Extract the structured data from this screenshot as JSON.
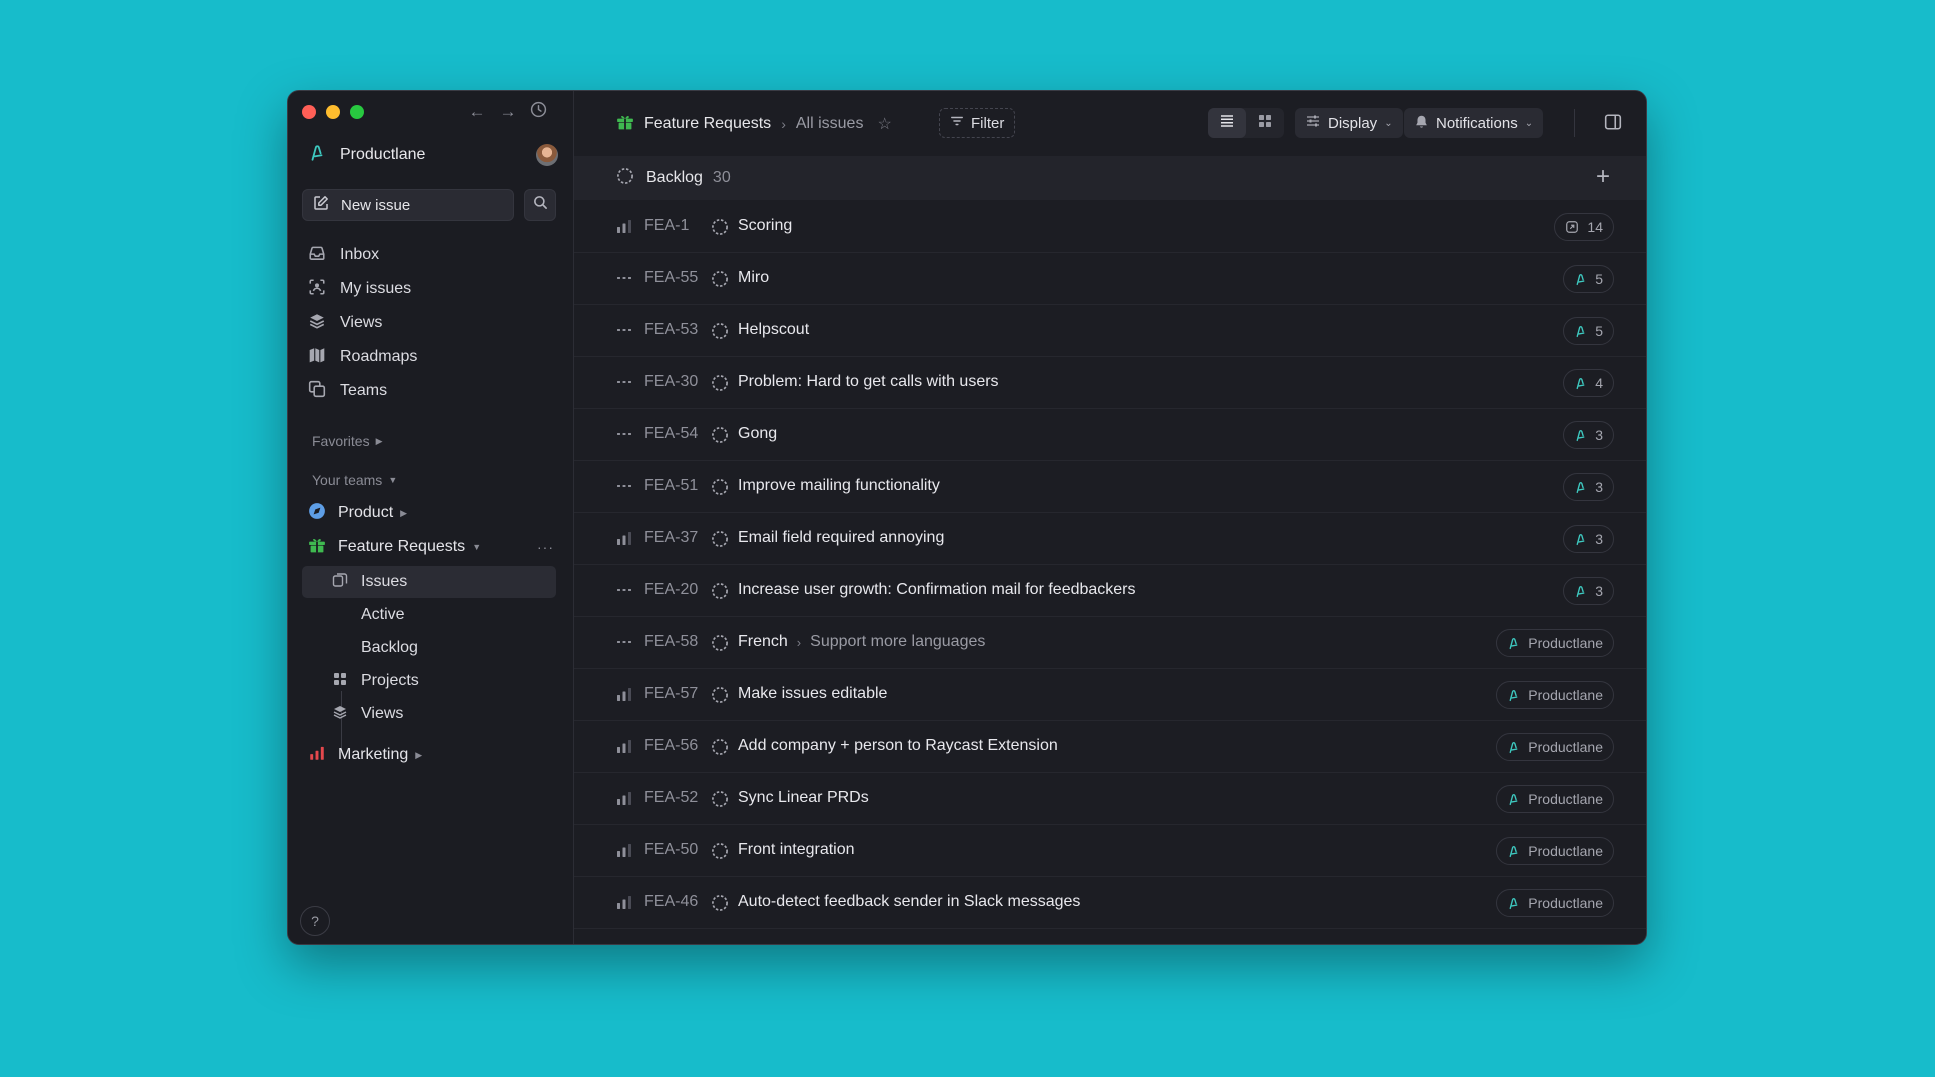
{
  "sidebar": {
    "workspace": "Productlane",
    "new_issue": "New issue",
    "nav": [
      {
        "label": "Inbox"
      },
      {
        "label": "My issues"
      },
      {
        "label": "Views"
      },
      {
        "label": "Roadmaps"
      },
      {
        "label": "Teams"
      }
    ],
    "favorites_label": "Favorites",
    "your_teams_label": "Your teams",
    "teams": [
      {
        "label": "Product"
      },
      {
        "label": "Feature Requests"
      },
      {
        "label": "Marketing"
      }
    ],
    "feature_requests_items": [
      "Issues",
      "Active",
      "Backlog",
      "Projects",
      "Views"
    ],
    "more_glyph": "···",
    "help_glyph": "?"
  },
  "header": {
    "team": "Feature Requests",
    "separator": "›",
    "view": "All issues",
    "filter": "Filter",
    "display": "Display",
    "notifications": "Notifications"
  },
  "group": {
    "label": "Backlog",
    "count": "30"
  },
  "issues": [
    {
      "id": "FEA-1",
      "title": "Scoring",
      "badge": "14",
      "badge_icon": "message-icon",
      "priority": "medium"
    },
    {
      "id": "FEA-55",
      "title": "Miro",
      "badge": "5",
      "badge_icon": "productlane-icon",
      "priority": "none"
    },
    {
      "id": "FEA-53",
      "title": "Helpscout",
      "badge": "5",
      "badge_icon": "productlane-icon",
      "priority": "none"
    },
    {
      "id": "FEA-30",
      "title": "Problem: Hard to get calls with users",
      "badge": "4",
      "badge_icon": "productlane-icon",
      "priority": "none"
    },
    {
      "id": "FEA-54",
      "title": "Gong",
      "badge": "3",
      "badge_icon": "productlane-icon",
      "priority": "none"
    },
    {
      "id": "FEA-51",
      "title": "Improve mailing functionality",
      "badge": "3",
      "badge_icon": "productlane-icon",
      "priority": "none"
    },
    {
      "id": "FEA-37",
      "title": "Email field required annoying",
      "badge": "3",
      "badge_icon": "productlane-icon",
      "priority": "medium"
    },
    {
      "id": "FEA-20",
      "title": "Increase user growth: Confirmation mail for feedbackers",
      "badge": "3",
      "badge_icon": "productlane-icon",
      "priority": "none"
    },
    {
      "id": "FEA-58",
      "title": "French",
      "parent": "Support more languages",
      "badge": "Productlane",
      "badge_icon": "productlane-icon",
      "priority": "none"
    },
    {
      "id": "FEA-57",
      "title": "Make issues editable",
      "badge": "Productlane",
      "badge_icon": "productlane-icon",
      "priority": "medium"
    },
    {
      "id": "FEA-56",
      "title": "Add company + person to Raycast Extension",
      "badge": "Productlane",
      "badge_icon": "productlane-icon",
      "priority": "medium"
    },
    {
      "id": "FEA-52",
      "title": "Sync Linear PRDs",
      "badge": "Productlane",
      "badge_icon": "productlane-icon",
      "priority": "medium"
    },
    {
      "id": "FEA-50",
      "title": "Front integration",
      "badge": "Productlane",
      "badge_icon": "productlane-icon",
      "priority": "medium"
    },
    {
      "id": "FEA-46",
      "title": "Auto-detect feedback sender in Slack messages",
      "badge": "Productlane",
      "badge_icon": "productlane-icon",
      "priority": "medium"
    }
  ],
  "colors": {
    "background": "#17bccb",
    "window": "#1b1c22",
    "accent_teal": "#3ec9c0",
    "feature_requests_green": "#3fb950",
    "marketing_red": "#e5484d",
    "product_blue": "#5e9ee6"
  }
}
